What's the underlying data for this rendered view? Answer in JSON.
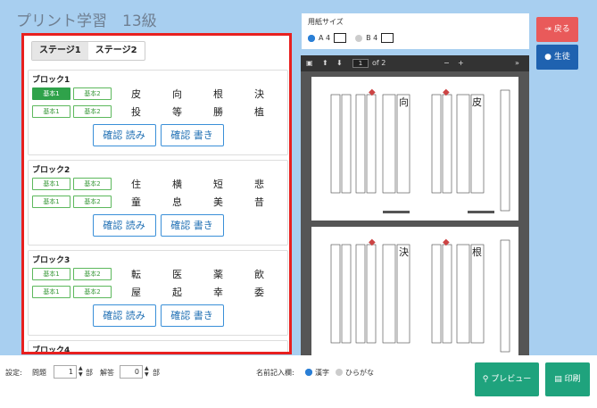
{
  "app": {
    "title": "プリント学習　13級"
  },
  "tabs": [
    "ステージ1",
    "ステージ2"
  ],
  "blocks": [
    {
      "title": "ブロック1",
      "rows": [
        {
          "k": [
            "皮",
            "向",
            "根",
            "決"
          ]
        },
        {
          "k": [
            "投",
            "等",
            "勝",
            "植"
          ]
        }
      ]
    },
    {
      "title": "ブロック2",
      "rows": [
        {
          "k": [
            "住",
            "横",
            "短",
            "悲"
          ]
        },
        {
          "k": [
            "童",
            "息",
            "美",
            "昔"
          ]
        }
      ]
    },
    {
      "title": "ブロック3",
      "rows": [
        {
          "k": [
            "転",
            "医",
            "薬",
            "飲"
          ]
        },
        {
          "k": [
            "屋",
            "起",
            "幸",
            "委"
          ]
        }
      ]
    }
  ],
  "block4_title": "ブロック4",
  "labels": {
    "kihon1": "基本1",
    "kihon2": "基本2",
    "check_read": "確認 読み",
    "check_write": "確認 書き"
  },
  "paper": {
    "label": "用紙サイズ",
    "a4": "A 4",
    "b4": "B 4"
  },
  "viewer": {
    "page": "1",
    "of": "of 2",
    "minus": "−",
    "plus": "+",
    "more": "»"
  },
  "buttons": {
    "back": "戻る",
    "student": "生徒",
    "preview": "プレビュー",
    "print": "印刷"
  },
  "settings": {
    "label": "設定:",
    "mondai": "問題",
    "mondai_val": "1",
    "bu": "部",
    "kaito": "解答",
    "kaito_val": "0",
    "bu2": "部",
    "name_label": "名前記入欄:",
    "kanji": "漢字",
    "hiragana": "ひらがな"
  },
  "icons": {
    "back": "sign-out-icon",
    "student": "user-icon",
    "preview": "search-icon",
    "print": "print-icon"
  }
}
